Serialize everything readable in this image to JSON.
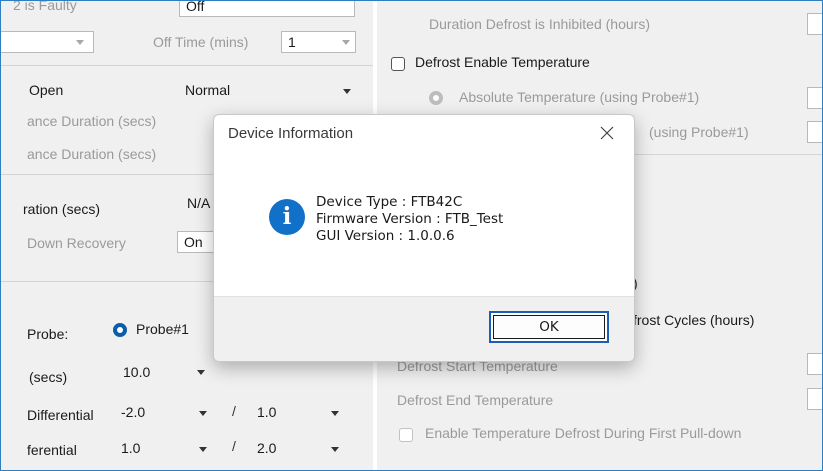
{
  "left": {
    "row0": {
      "label": "2 is Faulty",
      "value": "Off"
    },
    "row1": {
      "off_time_label": "Off Time (mins)",
      "off_time_value": "1"
    },
    "row2": {
      "label": "Open",
      "value": "Normal"
    },
    "row3": {
      "label": "ance Duration (secs)"
    },
    "row4": {
      "label": "ance Duration (secs)"
    },
    "row5": {
      "label": "ration (secs)",
      "value": "N/A"
    },
    "row6": {
      "label": "Down Recovery",
      "value": "On"
    },
    "probe": {
      "label": "Probe:",
      "option": "Probe#1"
    },
    "secs": {
      "label": "(secs)",
      "value": "10.0"
    },
    "diff1": {
      "label": "Differential",
      "value1": "-2.0",
      "sep": "/",
      "value2": "1.0"
    },
    "diff2": {
      "label": "ferential",
      "value1": "1.0",
      "sep": "/",
      "value2": "2.0"
    }
  },
  "right": {
    "inhibited": "Duration Defrost is Inhibited (hours)",
    "enable_temp": "Defrost Enable Temperature",
    "abs_temp": "Absolute Temperature (using Probe#1)",
    "partial": "(using Probe#1)",
    "paren": ")",
    "cycles": "frost Cycles (hours)",
    "start_temp": "Defrost Start Temperature",
    "end_temp": "Defrost End Temperature",
    "pull_down": "Enable Temperature Defrost During First Pull-down"
  },
  "dialog": {
    "title": "Device Information",
    "close_glyph": "×",
    "info_glyph": "i",
    "device_type": "Device Type : FTB42C",
    "firmware": "Firmware Version : FTB_Test",
    "gui": "GUI Version : 1.0.0.6",
    "ok_label": "OK"
  },
  "colors": {
    "accent": "#1a5fb4",
    "info": "#1171c9"
  }
}
